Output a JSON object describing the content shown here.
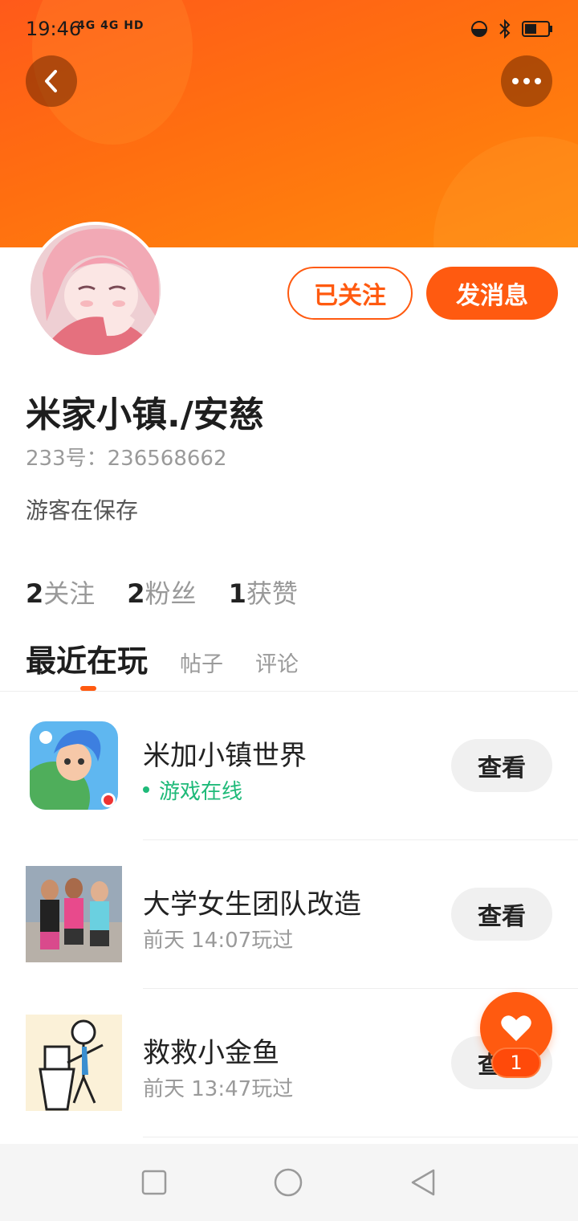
{
  "status_bar": {
    "time": "19:46",
    "network": "4G 4G HD"
  },
  "profile": {
    "username": "米家小镇./安慈",
    "uid": "233号：236568662",
    "bio": "游客在保存",
    "follow_label": "已关注",
    "message_label": "发消息"
  },
  "stats": [
    {
      "num": "2",
      "label": "关注"
    },
    {
      "num": "2",
      "label": "粉丝"
    },
    {
      "num": "1",
      "label": "获赞"
    }
  ],
  "tabs": {
    "active": "最近在玩",
    "posts": "帖子",
    "comments": "评论"
  },
  "games": [
    {
      "title": "米加小镇世界",
      "status": "游戏在线",
      "action": "查看"
    },
    {
      "title": "大学女生团队改造",
      "status": "前天 14:07玩过",
      "action": "查看"
    },
    {
      "title": "救救小金鱼",
      "status": "前天 13:47玩过",
      "action": "查看"
    }
  ],
  "like_fab": {
    "count": "1"
  },
  "colors": {
    "accent": "#ff5a10",
    "online": "#1fba79"
  },
  "icons": [
    "back-icon",
    "more-icon",
    "heart-icon",
    "square-nav-icon",
    "circle-nav-icon",
    "triangle-back-nav-icon"
  ]
}
